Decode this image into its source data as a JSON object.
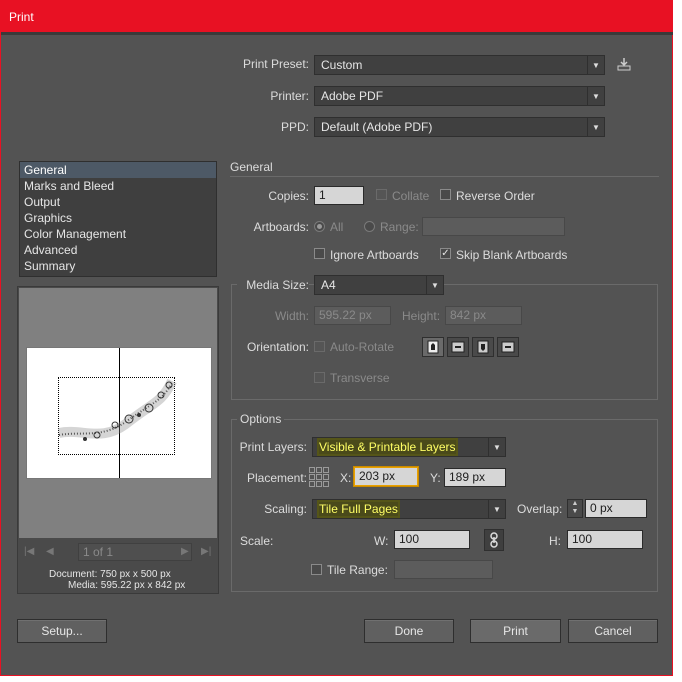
{
  "window": {
    "title": "Print"
  },
  "print_preset": {
    "label": "Print Preset:",
    "value": "Custom",
    "save_icon": "save-preset-icon"
  },
  "printer": {
    "label": "Printer:",
    "value": "Adobe PDF"
  },
  "ppd": {
    "label": "PPD:",
    "value": "Default (Adobe PDF)"
  },
  "sidebar": {
    "items": [
      {
        "label": "General",
        "selected": true
      },
      {
        "label": "Marks and Bleed"
      },
      {
        "label": "Output"
      },
      {
        "label": "Graphics"
      },
      {
        "label": "Color Management"
      },
      {
        "label": "Advanced"
      },
      {
        "label": "Summary"
      }
    ]
  },
  "preview": {
    "page_value": "1 of 1",
    "document_info": "Document: 750 px x 500 px",
    "media_info": "Media: 595.22 px x 842 px"
  },
  "general": {
    "heading": "General",
    "copies_label": "Copies:",
    "copies_value": "1",
    "collate_label": "Collate",
    "reverse_order_label": "Reverse Order",
    "artboards_label": "Artboards:",
    "all_label": "All",
    "range_label": "Range:",
    "range_value": "",
    "ignore_artboards_label": "Ignore Artboards",
    "skip_blank_label": "Skip Blank Artboards",
    "skip_blank_checked": true
  },
  "media": {
    "size_label": "Media Size:",
    "size_value": "A4",
    "width_label": "Width:",
    "width_value": "595.22 px",
    "height_label": "Height:",
    "height_value": "842 px",
    "orientation_label": "Orientation:",
    "auto_rotate_label": "Auto-Rotate",
    "transverse_label": "Transverse"
  },
  "options": {
    "heading": "Options",
    "print_layers_label": "Print Layers:",
    "print_layers_value": "Visible & Printable Layers",
    "placement_label": "Placement:",
    "x_label": "X:",
    "x_value": "203 px",
    "y_label": "Y:",
    "y_value": "189 px",
    "scaling_label": "Scaling:",
    "scaling_value": "Tile Full Pages",
    "overlap_label": "Overlap:",
    "overlap_value": "0 px",
    "scale_label": "Scale:",
    "w_label": "W:",
    "w_value": "100",
    "h_label": "H:",
    "h_value": "100",
    "tile_range_label": "Tile Range:",
    "tile_range_value": ""
  },
  "buttons": {
    "setup": "Setup...",
    "done": "Done",
    "print": "Print",
    "cancel": "Cancel"
  },
  "colors": {
    "titlebar": "#e81123",
    "dialog_bg": "#535353",
    "highlight": "#ffff66"
  }
}
